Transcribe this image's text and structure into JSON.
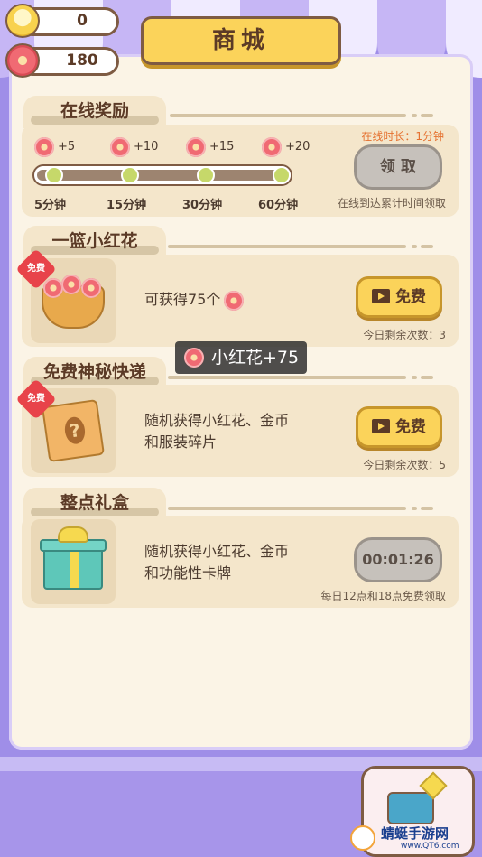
{
  "counters": {
    "bulb_value": "0",
    "flower_value": "180"
  },
  "header": {
    "title": "商城"
  },
  "online_reward": {
    "title": "在线奖励",
    "rewards": [
      {
        "amount": "+5",
        "time": "5分钟"
      },
      {
        "amount": "+10",
        "time": "15分钟"
      },
      {
        "amount": "+15",
        "time": "30分钟"
      },
      {
        "amount": "+20",
        "time": "60分钟"
      }
    ],
    "online_time": "在线时长：1分钟",
    "claim_label": "领 取",
    "note": "在线到达累计时间领取"
  },
  "basket": {
    "title": "一篮小红花",
    "badge": "免费",
    "desc_prefix": "可获得75个",
    "button_label": "免费",
    "remaining": "今日剩余次数：3"
  },
  "toast": {
    "text": "小红花+75"
  },
  "mystery": {
    "title": "免费神秘快递",
    "badge": "免费",
    "desc_line1": "随机获得小红花、金币",
    "desc_line2": "和服装碎片",
    "button_label": "免费",
    "remaining": "今日剩余次数：5"
  },
  "hourly": {
    "title": "整点礼盒",
    "desc_line1": "随机获得小红花、金币",
    "desc_line2": "和功能性卡牌",
    "timer": "00:01:26",
    "note": "每日12点和18点免费领取"
  },
  "watermark": {
    "name": "蜻蜓手游网",
    "url": "www.QT6.com"
  },
  "colors": {
    "accent": "#fbd35a",
    "brown": "#5b3a26",
    "purple": "#9f8ee8",
    "red": "#e8434a",
    "orange_text": "#e5702f"
  }
}
